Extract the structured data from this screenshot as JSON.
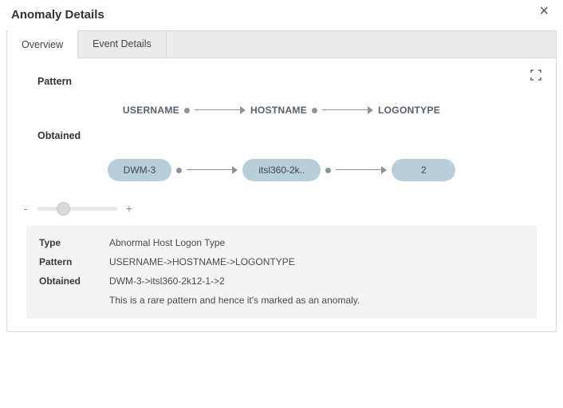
{
  "header": {
    "title": "Anomaly Details"
  },
  "tabs": {
    "overview": "Overview",
    "event_details": "Event Details"
  },
  "sections": {
    "pattern": "Pattern",
    "obtained": "Obtained"
  },
  "pattern_flow": {
    "n1": "USERNAME",
    "n2": "HOSTNAME",
    "n3": "LOGONTYPE"
  },
  "obtained_flow": {
    "n1": "DWM-3",
    "n2": "itsl360-2k..",
    "n3": "2"
  },
  "slider": {
    "minus": "-",
    "plus": "+"
  },
  "details": {
    "labels": {
      "type": "Type",
      "pattern": "Pattern",
      "obtained": "Obtained"
    },
    "type": "Abnormal Host Logon Type",
    "pattern": "USERNAME->HOSTNAME->LOGONTYPE",
    "obtained": "DWM-3->itsl360-2k12-1->2",
    "description": "This is a rare pattern and hence it's marked as an anomaly."
  }
}
